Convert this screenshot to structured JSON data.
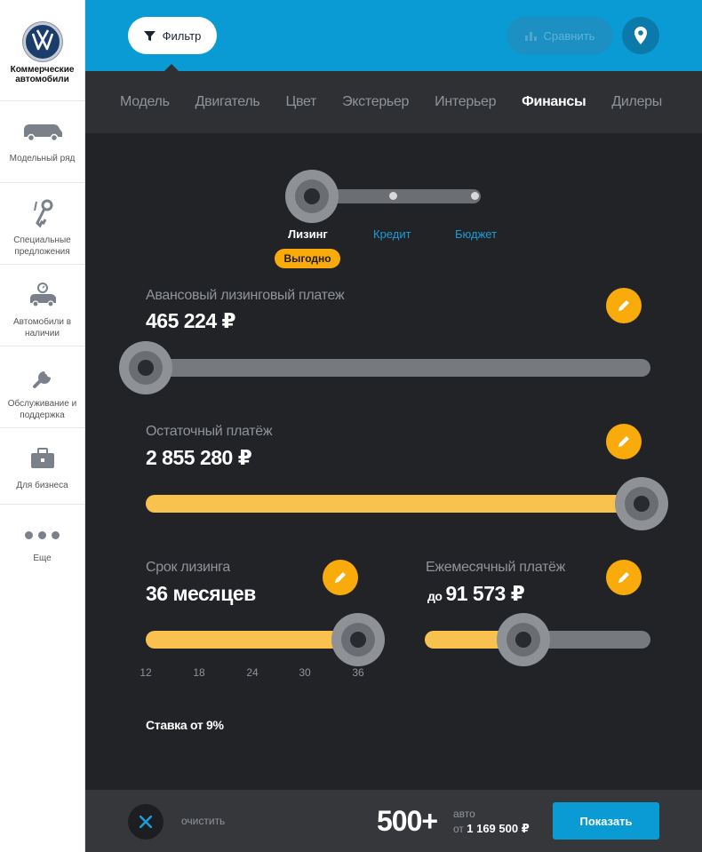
{
  "sidebar": {
    "brand": "Коммерческие автомобили",
    "items": [
      {
        "label": "Модельный ряд",
        "icon": "van-icon"
      },
      {
        "label": "Специальные предложения",
        "icon": "keys-icon"
      },
      {
        "label": "Автомобили в наличии",
        "icon": "car-timer-icon"
      },
      {
        "label": "Обслуживание и поддержка",
        "icon": "wrench-icon"
      },
      {
        "label": "Для бизнеса",
        "icon": "briefcase-icon"
      }
    ],
    "more_label": "Еще"
  },
  "topbar": {
    "filter_label": "Фильтр",
    "compare_label": "Сравнить",
    "colors": {
      "bar": "#0a9ad4",
      "accent": "#f9ab0b"
    }
  },
  "tabs": [
    "Модель",
    "Двигатель",
    "Цвет",
    "Экстерьер",
    "Интерьер",
    "Финансы",
    "Дилеры"
  ],
  "active_tab": "Финансы",
  "finance": {
    "modes": {
      "leasing": "Лизинг",
      "credit": "Кредит",
      "budget": "Бюджет"
    },
    "selected_mode": "Лизинг",
    "badge": "Выгодно",
    "advance": {
      "label": "Авансовый лизинговый платеж",
      "value": "465 224 ₽",
      "slider_fraction": 0.0
    },
    "residual": {
      "label": "Остаточный платёж",
      "value": "2 855 280 ₽",
      "slider_fraction": 1.0
    },
    "term": {
      "label": "Срок лизинга",
      "value": "36 месяцев",
      "ticks": [
        "12",
        "18",
        "24",
        "30",
        "36"
      ],
      "selected": "36"
    },
    "monthly": {
      "label": "Ежемесячный платёж",
      "prefix": "до",
      "value": "91 573 ₽",
      "slider_fraction": 0.44
    },
    "rate": "Ставка от 9%"
  },
  "footer": {
    "clear_label": "очистить",
    "count": "500+",
    "count_unit": "авто",
    "price_prefix": "от",
    "price": "1 169 500 ₽",
    "show_label": "Показать"
  }
}
